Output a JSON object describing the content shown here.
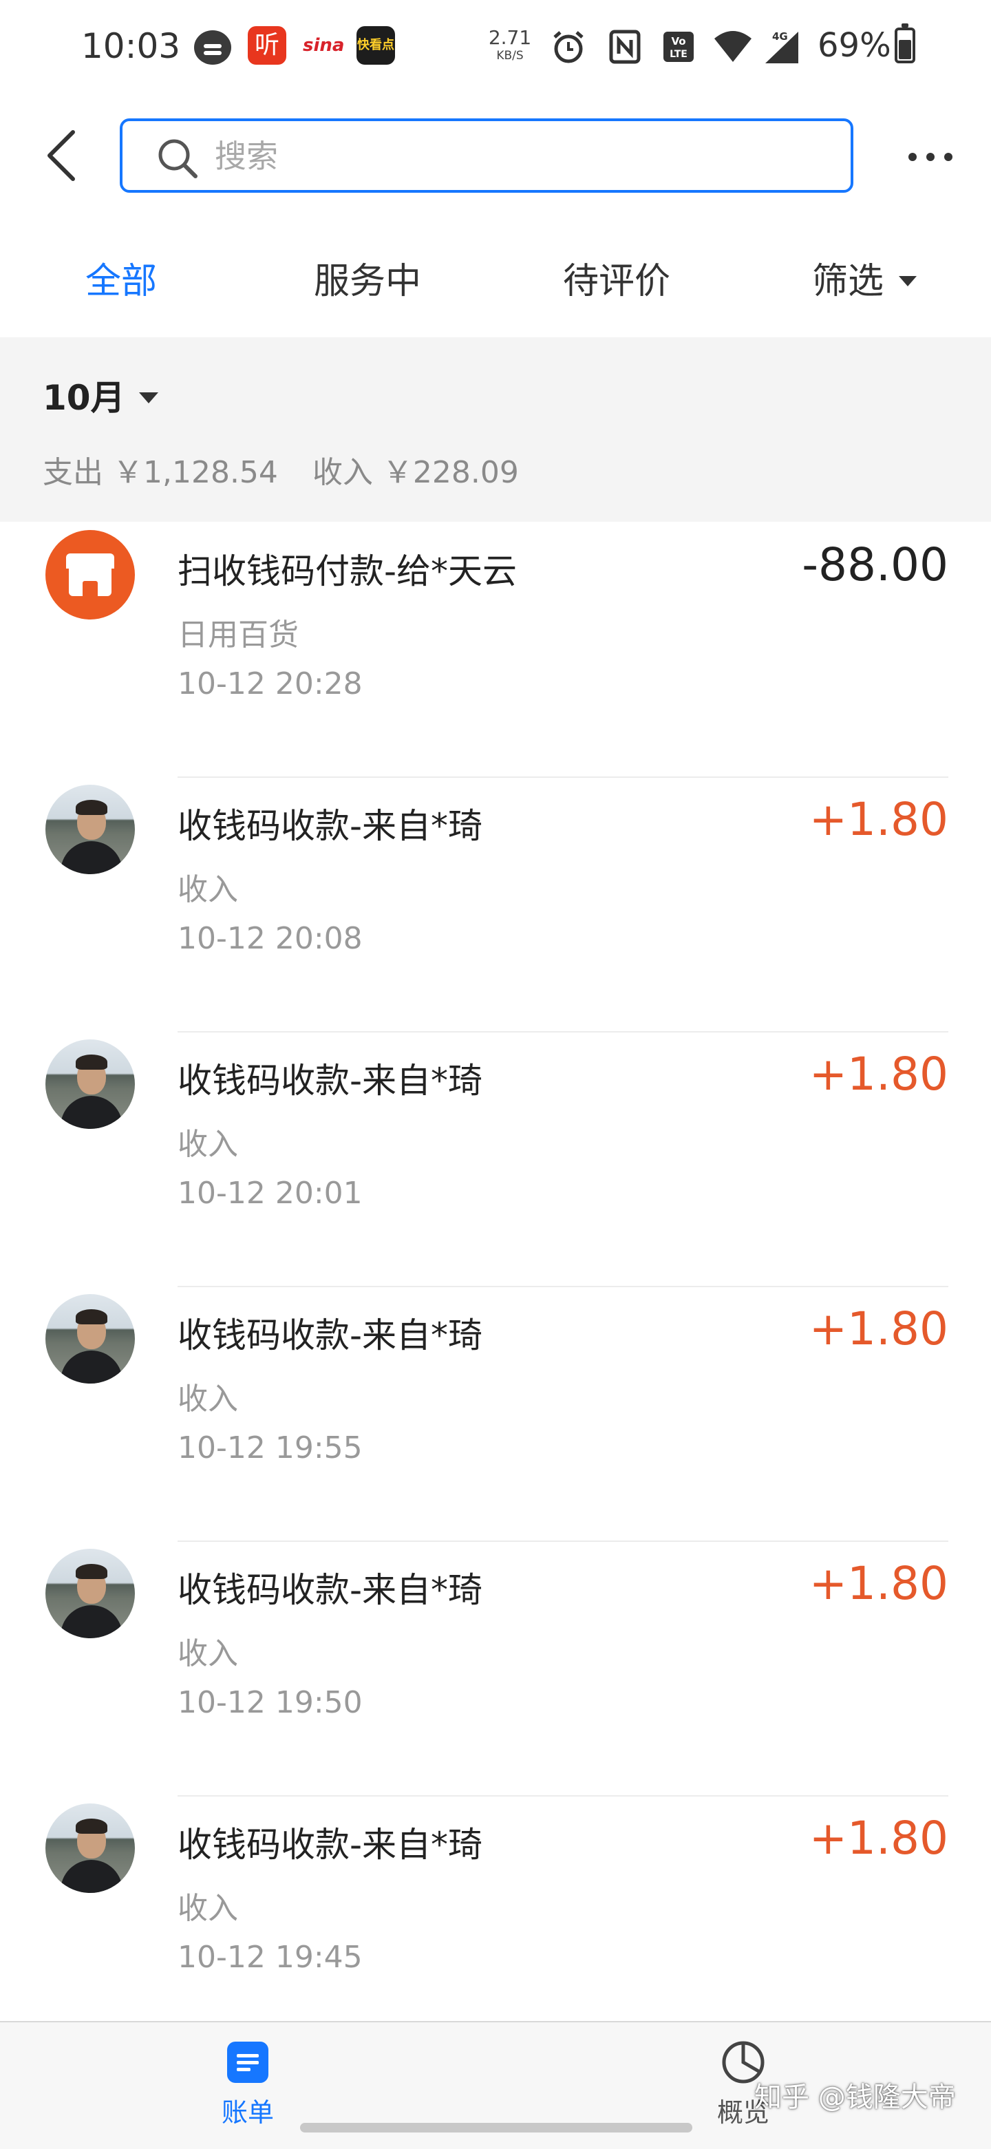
{
  "status_bar": {
    "time": "10:03",
    "net_speed_value": "2.71",
    "net_speed_unit": "KB/S",
    "notification_ting_text": "听",
    "notification_sina_text": "sina",
    "notification_kuaikan_text": "快看点",
    "battery_percent": "69%",
    "battery_level": 0.69,
    "icons": [
      "chat-icon",
      "alarm-icon",
      "nfc-icon",
      "volte-icon",
      "wifi-icon",
      "signal-4g-icon",
      "battery-icon"
    ]
  },
  "header": {
    "search_placeholder": "搜索",
    "back_icon": "chevron-left-icon",
    "more_icon": "more-dots-icon"
  },
  "tabs": [
    {
      "label": "全部",
      "active": true
    },
    {
      "label": "服务中",
      "active": false
    },
    {
      "label": "待评价",
      "active": false
    },
    {
      "label": "筛选",
      "active": false
    }
  ],
  "summary": {
    "month": "10月",
    "expense": "支出 ￥1,128.54",
    "income": "收入 ￥228.09"
  },
  "records": [
    {
      "title": "扫收钱码付款-给*天云",
      "category": "日用百货",
      "datetime": "10-12  20:28",
      "amount": "-88.00",
      "type": "expense",
      "icon": "shop-icon"
    },
    {
      "title": "收钱码收款-来自*琦",
      "category": "收入",
      "datetime": "10-12  20:08",
      "amount": "+1.80",
      "type": "income",
      "icon": "avatar"
    },
    {
      "title": "收钱码收款-来自*琦",
      "category": "收入",
      "datetime": "10-12  20:01",
      "amount": "+1.80",
      "type": "income",
      "icon": "avatar"
    },
    {
      "title": "收钱码收款-来自*琦",
      "category": "收入",
      "datetime": "10-12  19:55",
      "amount": "+1.80",
      "type": "income",
      "icon": "avatar"
    },
    {
      "title": "收钱码收款-来自*琦",
      "category": "收入",
      "datetime": "10-12  19:50",
      "amount": "+1.80",
      "type": "income",
      "icon": "avatar"
    },
    {
      "title": "收钱码收款-来自*琦",
      "category": "收入",
      "datetime": "10-12  19:45",
      "amount": "+1.80",
      "type": "income",
      "icon": "avatar"
    }
  ],
  "bottom_nav": [
    {
      "label": "账单",
      "icon": "bill-icon",
      "active": true
    },
    {
      "label": "概览",
      "icon": "pie-chart-icon",
      "active": false
    }
  ],
  "watermark": "知乎 @钱隆大帝",
  "colors": {
    "accent": "#1677ff",
    "income": "#e5592b",
    "shop_icon": "#ec5a22",
    "summary_bg": "#f4f4f4"
  }
}
